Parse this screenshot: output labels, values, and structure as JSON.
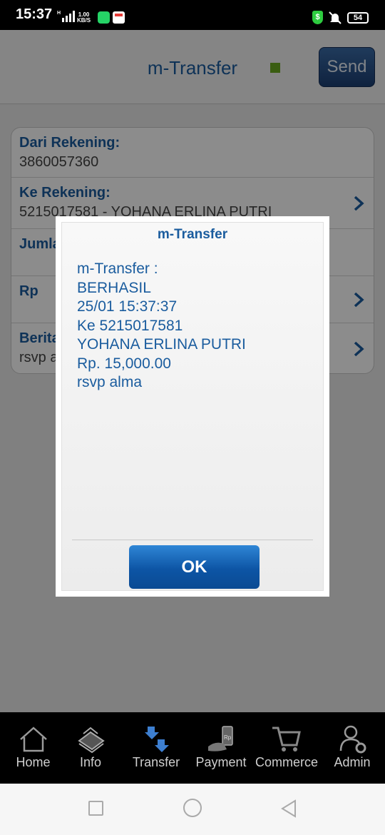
{
  "status_bar": {
    "time": "15:37",
    "net_speed_value": "1.00",
    "net_speed_unit": "KB/S",
    "battery": "54"
  },
  "header": {
    "title": "m-Transfer",
    "send_label": "Send",
    "status_color": "#6aaa1f"
  },
  "form": {
    "rows": [
      {
        "label": "Dari Rekening:",
        "value": "3860057360"
      },
      {
        "label": "Ke Rekening:",
        "value": "5215017581 - YOHANA ERLINA PUTRI"
      },
      {
        "label": "Jumla",
        "value": ""
      },
      {
        "label": "Rp",
        "value": ""
      },
      {
        "label": "Berita",
        "value": "rsvp a"
      }
    ]
  },
  "dialog": {
    "title": "m-Transfer",
    "lines": [
      "m-Transfer :",
      "BERHASIL",
      "25/01 15:37:37",
      "Ke 5215017581",
      "YOHANA ERLINA PUTRI",
      "Rp. 15,000.00",
      "rsvp alma"
    ],
    "ok_label": "OK"
  },
  "bottom_nav": [
    {
      "label": "Home",
      "icon": "home-icon"
    },
    {
      "label": "Info",
      "icon": "info-book-icon"
    },
    {
      "label": "Transfer",
      "icon": "transfer-icon"
    },
    {
      "label": "Payment",
      "icon": "payment-icon"
    },
    {
      "label": "Commerce",
      "icon": "cart-icon"
    },
    {
      "label": "Admin",
      "icon": "admin-icon"
    }
  ],
  "colors": {
    "accent": "#1a5c9e",
    "ok_button": "#0d55a5",
    "nav_active": "#3d7fd1"
  }
}
